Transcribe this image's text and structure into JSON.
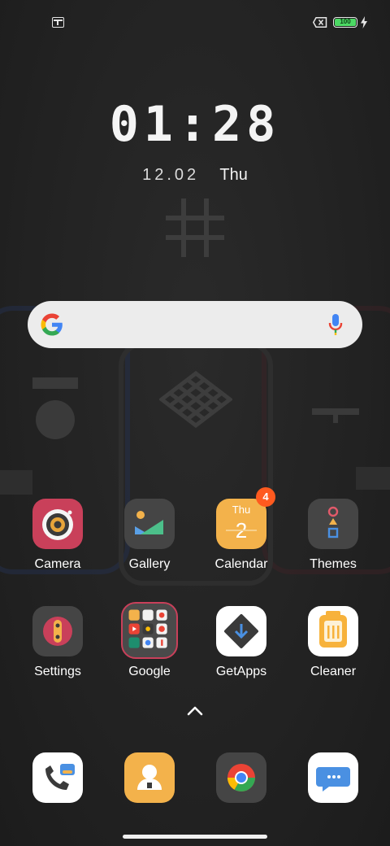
{
  "status_bar": {
    "left_icon": "screenshot-notification-icon",
    "sim_icon": "no-sim-icon",
    "battery_level": "100",
    "charging_icon": "bolt-icon",
    "battery_color": "#4cd964"
  },
  "clock": {
    "time": "01:28",
    "date": "12.02",
    "weekday": "Thu"
  },
  "search_bar": {
    "left_icon": "google-g-icon",
    "right_icon": "mic-icon"
  },
  "apps": [
    {
      "label": "Camera",
      "icon": "camera-icon",
      "color": "#c9405a"
    },
    {
      "label": "Gallery",
      "icon": "gallery-icon",
      "color": "#454545"
    },
    {
      "label": "Calendar",
      "icon": "calendar-icon",
      "color": "#f3b24b",
      "icon_day": "Thu",
      "icon_date": "2",
      "badge": "4"
    },
    {
      "label": "Themes",
      "icon": "themes-icon",
      "color": "#454545"
    },
    {
      "label": "Settings",
      "icon": "settings-icon",
      "color": "#454545"
    },
    {
      "label": "Google",
      "icon": "google-folder-icon",
      "color": "#454545"
    },
    {
      "label": "GetApps",
      "icon": "getapps-icon",
      "color": "#ffffff"
    },
    {
      "label": "Cleaner",
      "icon": "cleaner-icon",
      "color": "#ffffff"
    }
  ],
  "app_drawer_icon": "chevron-up-icon",
  "dock": [
    {
      "icon": "phone-icon"
    },
    {
      "icon": "contacts-icon"
    },
    {
      "icon": "chrome-icon"
    },
    {
      "icon": "messages-icon"
    }
  ],
  "colors": {
    "badge": "#ff5a1f",
    "accent_yellow": "#f3b24b"
  }
}
